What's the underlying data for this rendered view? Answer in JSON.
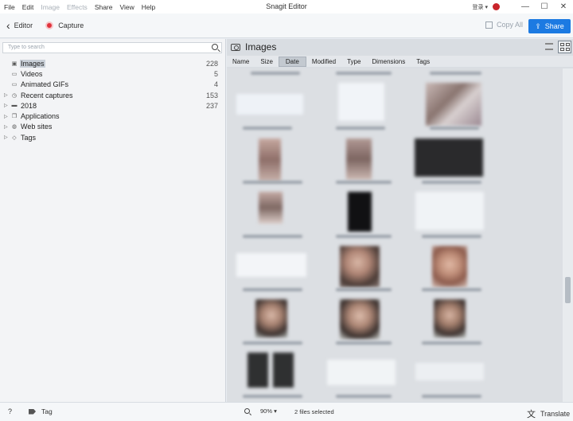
{
  "menu": [
    "File",
    "Edit",
    "Image",
    "Effects",
    "Share",
    "View",
    "Help"
  ],
  "menu_disabled": [
    "Image",
    "Effects"
  ],
  "app_title": "Snagit Editor",
  "user_menu": "登录 ▾",
  "window_controls": {
    "minimize": "—",
    "maximize": "☐",
    "close": "✕"
  },
  "toolbar": {
    "editor_label": "Editor",
    "capture_label": "Capture",
    "copy_all_label": "Copy All",
    "share_label": "Share"
  },
  "search": {
    "placeholder": "Type to search"
  },
  "tree": [
    {
      "label": "Images",
      "count": "228",
      "expandable": false,
      "icon": "camera-icon",
      "selected": true
    },
    {
      "label": "Videos",
      "count": "5",
      "expandable": false,
      "icon": "video-icon",
      "selected": false
    },
    {
      "label": "Animated GIFs",
      "count": "4",
      "expandable": false,
      "icon": "gif-icon",
      "selected": false
    },
    {
      "label": "Recent captures",
      "count": "153",
      "expandable": true,
      "icon": "clock-icon",
      "selected": false
    },
    {
      "label": "2018",
      "count": "237",
      "expandable": true,
      "icon": "folder-icon",
      "selected": false
    },
    {
      "label": "Applications",
      "count": "",
      "expandable": true,
      "icon": "window-icon",
      "selected": false
    },
    {
      "label": "Web sites",
      "count": "",
      "expandable": true,
      "icon": "globe-icon",
      "selected": false
    },
    {
      "label": "Tags",
      "count": "",
      "expandable": true,
      "icon": "tag-icon",
      "selected": false
    }
  ],
  "panel_title": "Images",
  "sort_columns": [
    {
      "label": "Name",
      "active": false
    },
    {
      "label": "Size",
      "active": false
    },
    {
      "label": "Date",
      "active": true
    },
    {
      "label": "Modified",
      "active": false
    },
    {
      "label": "Type",
      "active": false
    },
    {
      "label": "Dimensions",
      "active": false
    },
    {
      "label": "Tags",
      "active": false
    }
  ],
  "statusbar": {
    "help_label": "?",
    "tag_label": "Tag",
    "zoom_value": "90% ▾",
    "files_selected": "2 files selected",
    "translate_label": "Translate"
  },
  "colors": {
    "accent": "#1c7ae2",
    "record": "#e0323c",
    "selection": "#c9d0d8"
  }
}
